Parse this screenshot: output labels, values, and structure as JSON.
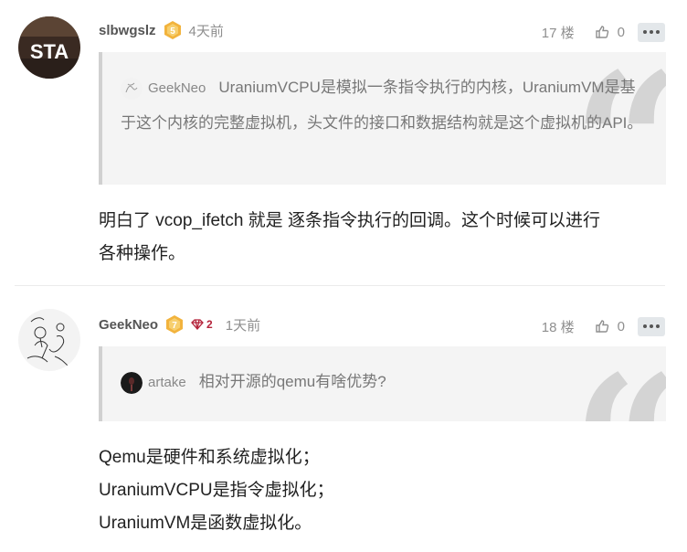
{
  "posts": [
    {
      "username": "slbwgslz",
      "level": "5",
      "time": "4天前",
      "floor": "17 楼",
      "likes": "0",
      "avatar_text": "STA",
      "quote": {
        "username": "GeekNeo",
        "text": "UraniumVCPU是模拟一条指令执行的内核，UraniumVM是基于这个内核的完整虚拟机，头文件的接口和数据结构就是这个虚拟机的API。"
      },
      "body": [
        "明白了 vcop_ifetch 就是 逐条指令执行的回调。这个时候可以进行",
        "各种操作。"
      ]
    },
    {
      "username": "GeekNeo",
      "level": "7",
      "gems": "2",
      "time": "1天前",
      "floor": "18 楼",
      "likes": "0",
      "quote": {
        "username": "artake",
        "text": "相对开源的qemu有啥优势?"
      },
      "body": [
        "Qemu是硬件和系统虚拟化；",
        "UraniumVCPU是指令虚拟化；",
        "UraniumVM是函数虚拟化。"
      ]
    }
  ],
  "colors": {
    "badge": "#f2b33d",
    "gem": "#b4233a",
    "quote_bg": "#f4f4f4",
    "more_bg": "#e3e7ea"
  },
  "icons": {
    "like": "thumbs-up-icon",
    "more": "more-dots-icon",
    "gem": "diamond-icon",
    "level": "level-badge-icon",
    "quote": "quote-mark-icon"
  }
}
